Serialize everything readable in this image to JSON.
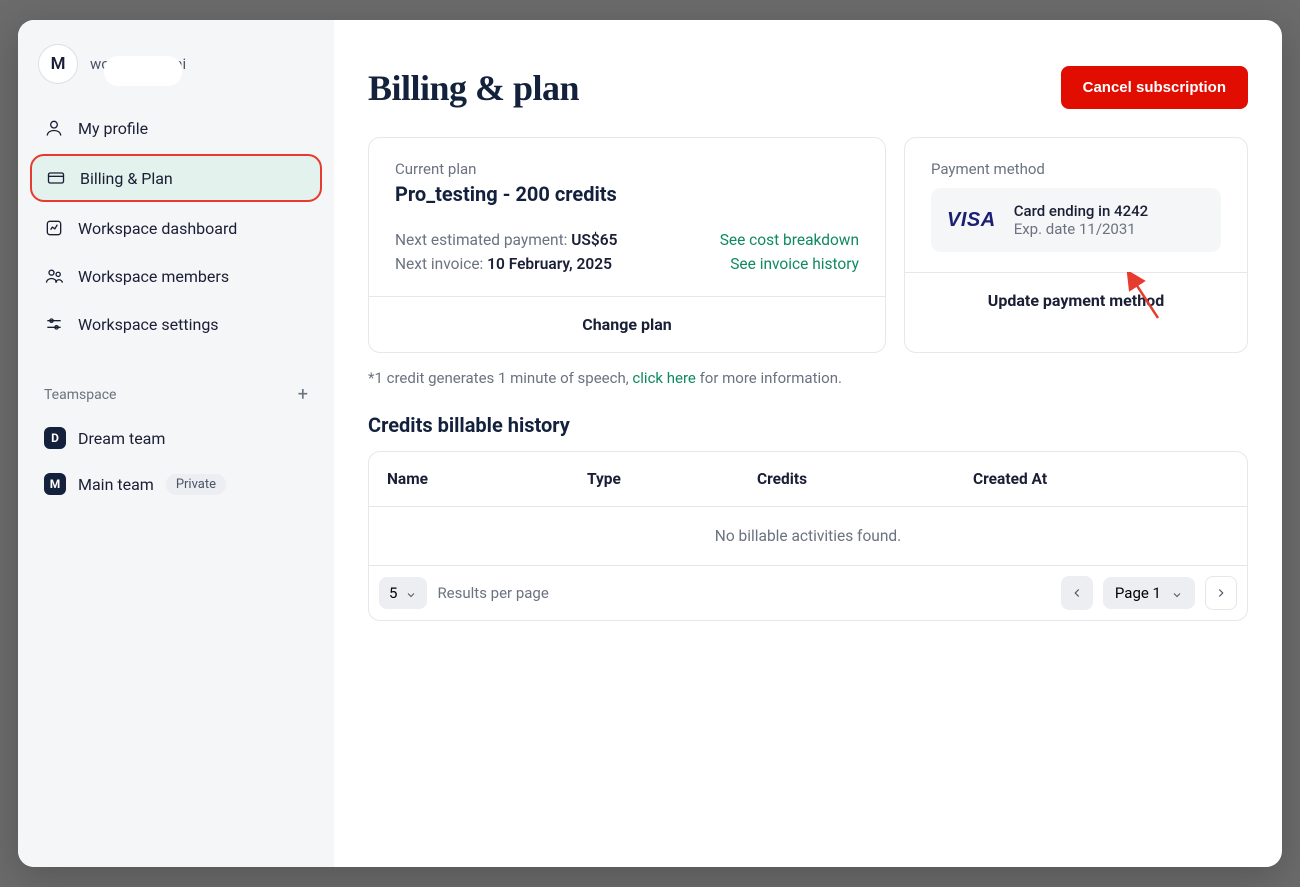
{
  "user": {
    "avatar_initial": "M",
    "email_suffix": "wondercraft.ai"
  },
  "sidebar": {
    "items": [
      {
        "label": "My profile"
      },
      {
        "label": "Billing & Plan"
      },
      {
        "label": "Workspace dashboard"
      },
      {
        "label": "Workspace members"
      },
      {
        "label": "Workspace settings"
      }
    ],
    "section_label": "Teamspace",
    "teams": [
      {
        "initial": "D",
        "label": "Dream team"
      },
      {
        "initial": "M",
        "label": "Main team",
        "badge": "Private"
      }
    ]
  },
  "header": {
    "title": "Billing & plan",
    "cancel_label": "Cancel subscription"
  },
  "plan_card": {
    "label": "Current plan",
    "name": "Pro_testing - 200 credits",
    "next_payment_label": "Next estimated payment: ",
    "next_payment_value": "US$65",
    "next_invoice_label": "Next invoice: ",
    "next_invoice_value": "10 February, 2025",
    "cost_breakdown_label": "See cost breakdown",
    "invoice_history_label": "See invoice history",
    "change_plan_label": "Change plan"
  },
  "payment_card": {
    "label": "Payment method",
    "brand": "VISA",
    "card_line": "Card ending in 4242",
    "exp_line": "Exp. date 11/2031",
    "update_label": "Update payment method"
  },
  "footnote": {
    "prefix": "*1 credit generates 1 minute of speech, ",
    "link": "click here",
    "suffix": " for more information."
  },
  "history": {
    "heading": "Credits billable history",
    "columns": [
      "Name",
      "Type",
      "Credits",
      "Created At"
    ],
    "empty": "No billable activities found.",
    "per_page_value": "5",
    "per_page_label": "Results per page",
    "page_label": "Page 1"
  },
  "colors": {
    "danger": "#e10d00",
    "accent_border": "#e63b2e",
    "link_green": "#0f8a5f"
  }
}
